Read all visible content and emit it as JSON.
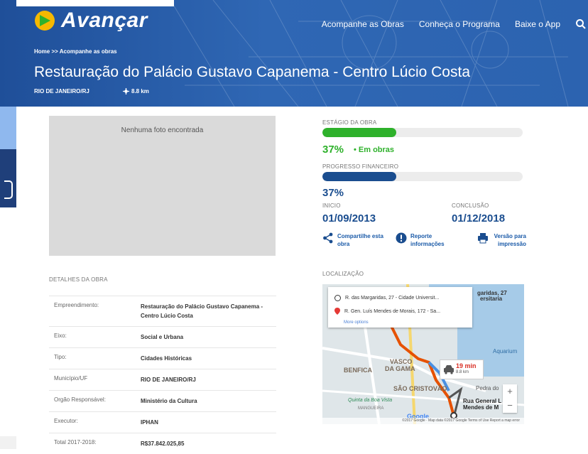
{
  "brand": {
    "name": "Avançar"
  },
  "nav": {
    "items": [
      "Acompanhe as Obras",
      "Conheça o Programa",
      "Baixe o App"
    ]
  },
  "breadcrumb": "Home >> Acompanhe as obras",
  "project": {
    "title": "Restauração do Palácio Gustavo Capanema - Centro Lúcio Costa",
    "location": "RIO DE JANEIRO/RJ",
    "distance": "8.8 km"
  },
  "photo": {
    "empty_text": "Nenhuma foto encontrada"
  },
  "stage": {
    "label": "ESTÁGIO DA OBRA",
    "percent": "37%",
    "percent_value": 37,
    "status": "• Em obras",
    "color": "#2eb12b"
  },
  "finance": {
    "label": "PROGRESSO FINANCEIRO",
    "percent": "37%",
    "percent_value": 37,
    "color": "#1a4d8f"
  },
  "dates": {
    "start_label": "INICIO",
    "start_value": "01/09/2013",
    "end_label": "CONCLUSÃO",
    "end_value": "01/12/2018"
  },
  "actions": {
    "share": "Compartilhe esta obra",
    "report": "Reporte informações",
    "print": "Versão para impressão"
  },
  "details": {
    "heading": "DETALHES DA OBRA",
    "rows": [
      {
        "key": "Empreendimento:",
        "value": "Restauração do Palácio Gustavo Capanema - Centro Lúcio Costa"
      },
      {
        "key": "Eixo:",
        "value": "Social e Urbana"
      },
      {
        "key": "Tipo:",
        "value": "Cidades Históricas"
      },
      {
        "key": "Município/UF",
        "value": "RIO DE JANEIRO/RJ"
      },
      {
        "key": "Orgão Responsável:",
        "value": "Ministério da Cultura"
      },
      {
        "key": "Executor:",
        "value": "IPHAN"
      },
      {
        "key": "Total 2017-2018:",
        "value": "R$37.842.025,85"
      }
    ]
  },
  "map": {
    "heading": "LOCALIZAÇÃO",
    "origin": "R. das Margaridas, 27 - Cidade Universit...",
    "destination": "R. Gen. Luís Mendes de Morais, 172 - Sa...",
    "more_options": "More options",
    "travel_time": "19 min",
    "travel_distance": "8.8 km",
    "place_labels": [
      "BENFICA",
      "DA GAMA",
      "VASCO",
      "SÃO CRISTOVÃO",
      "Quinta da Boa Vista",
      "MANGUEIRA",
      "Aquarium",
      "Rua General L",
      "Mendes de M",
      "Pedra do",
      "garidas, 27",
      "ersitaria"
    ],
    "attribution": "©2017 Google · Map data ©2017 Google   Terms of Use   Report a map error",
    "google": "Google"
  }
}
